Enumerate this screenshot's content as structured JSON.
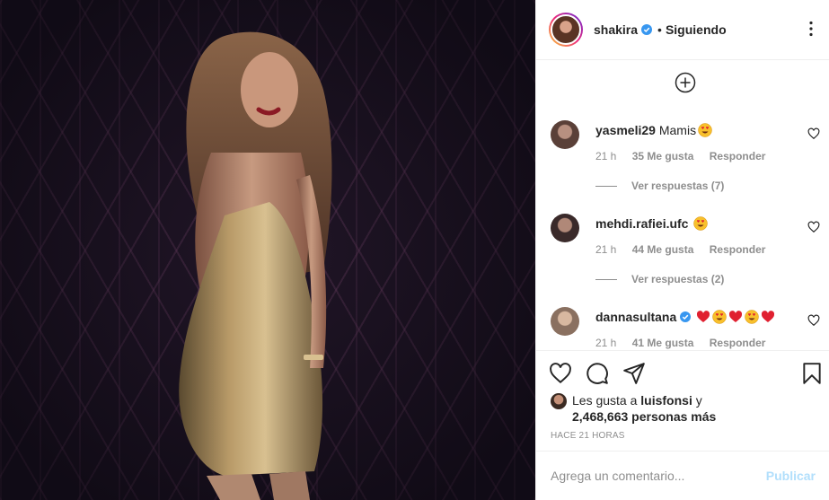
{
  "post": {
    "username": "shakira",
    "following_label": "Siguiendo",
    "separator": "•"
  },
  "comments": [
    {
      "username": "yasmeli29",
      "text": "Mamis",
      "emojis": [
        "heart-eyes"
      ],
      "time": "21 h",
      "likes": "35 Me gusta",
      "reply": "Responder",
      "view_replies": "Ver respuestas (7)"
    },
    {
      "username": "mehdi.rafiei.ufc",
      "text": "",
      "emojis": [
        "heart-eyes"
      ],
      "time": "21 h",
      "likes": "44 Me gusta",
      "reply": "Responder",
      "view_replies": "Ver respuestas (2)"
    },
    {
      "username": "dannasultana",
      "text": "",
      "verified": true,
      "emojis": [
        "red-heart",
        "heart-eyes",
        "red-heart",
        "heart-eyes",
        "red-heart"
      ],
      "time": "21 h",
      "likes": "41 Me gusta",
      "reply": "Responder"
    }
  ],
  "likes": {
    "prefix": "Les gusta a",
    "user": "luisfonsi",
    "conjunction": "y",
    "count_text": "2,468,663 personas más"
  },
  "timestamp": "HACE 21 HORAS",
  "composer": {
    "placeholder": "Agrega un comentario...",
    "post_label": "Publicar"
  },
  "colors": {
    "verified": "#3897f0",
    "link_disabled": "#b2dffc",
    "meta": "#8e8e8e",
    "heart_red": "#ed4956"
  }
}
